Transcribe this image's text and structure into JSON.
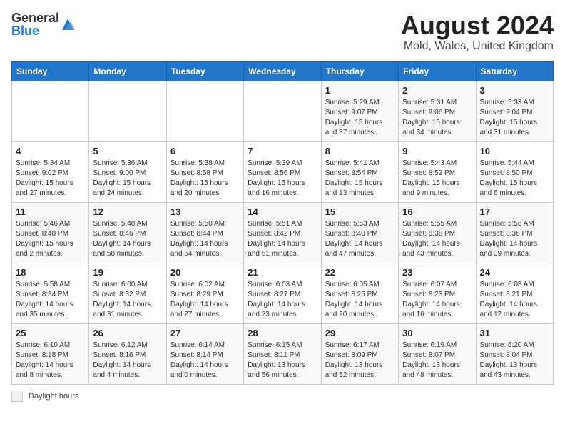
{
  "logo": {
    "text_general": "General",
    "text_blue": "Blue"
  },
  "header": {
    "title": "August 2024",
    "subtitle": "Mold, Wales, United Kingdom"
  },
  "days_of_week": [
    "Sunday",
    "Monday",
    "Tuesday",
    "Wednesday",
    "Thursday",
    "Friday",
    "Saturday"
  ],
  "weeks": [
    [
      {
        "day": "",
        "info": ""
      },
      {
        "day": "",
        "info": ""
      },
      {
        "day": "",
        "info": ""
      },
      {
        "day": "",
        "info": ""
      },
      {
        "day": "1",
        "info": "Sunrise: 5:29 AM\nSunset: 9:07 PM\nDaylight: 15 hours\nand 37 minutes."
      },
      {
        "day": "2",
        "info": "Sunrise: 5:31 AM\nSunset: 9:06 PM\nDaylight: 15 hours\nand 34 minutes."
      },
      {
        "day": "3",
        "info": "Sunrise: 5:33 AM\nSunset: 9:04 PM\nDaylight: 15 hours\nand 31 minutes."
      }
    ],
    [
      {
        "day": "4",
        "info": "Sunrise: 5:34 AM\nSunset: 9:02 PM\nDaylight: 15 hours\nand 27 minutes."
      },
      {
        "day": "5",
        "info": "Sunrise: 5:36 AM\nSunset: 9:00 PM\nDaylight: 15 hours\nand 24 minutes."
      },
      {
        "day": "6",
        "info": "Sunrise: 5:38 AM\nSunset: 8:58 PM\nDaylight: 15 hours\nand 20 minutes."
      },
      {
        "day": "7",
        "info": "Sunrise: 5:39 AM\nSunset: 8:56 PM\nDaylight: 15 hours\nand 16 minutes."
      },
      {
        "day": "8",
        "info": "Sunrise: 5:41 AM\nSunset: 8:54 PM\nDaylight: 15 hours\nand 13 minutes."
      },
      {
        "day": "9",
        "info": "Sunrise: 5:43 AM\nSunset: 8:52 PM\nDaylight: 15 hours\nand 9 minutes."
      },
      {
        "day": "10",
        "info": "Sunrise: 5:44 AM\nSunset: 8:50 PM\nDaylight: 15 hours\nand 6 minutes."
      }
    ],
    [
      {
        "day": "11",
        "info": "Sunrise: 5:46 AM\nSunset: 8:48 PM\nDaylight: 15 hours\nand 2 minutes."
      },
      {
        "day": "12",
        "info": "Sunrise: 5:48 AM\nSunset: 8:46 PM\nDaylight: 14 hours\nand 58 minutes."
      },
      {
        "day": "13",
        "info": "Sunrise: 5:50 AM\nSunset: 8:44 PM\nDaylight: 14 hours\nand 54 minutes."
      },
      {
        "day": "14",
        "info": "Sunrise: 5:51 AM\nSunset: 8:42 PM\nDaylight: 14 hours\nand 51 minutes."
      },
      {
        "day": "15",
        "info": "Sunrise: 5:53 AM\nSunset: 8:40 PM\nDaylight: 14 hours\nand 47 minutes."
      },
      {
        "day": "16",
        "info": "Sunrise: 5:55 AM\nSunset: 8:38 PM\nDaylight: 14 hours\nand 43 minutes."
      },
      {
        "day": "17",
        "info": "Sunrise: 5:56 AM\nSunset: 8:36 PM\nDaylight: 14 hours\nand 39 minutes."
      }
    ],
    [
      {
        "day": "18",
        "info": "Sunrise: 5:58 AM\nSunset: 8:34 PM\nDaylight: 14 hours\nand 35 minutes."
      },
      {
        "day": "19",
        "info": "Sunrise: 6:00 AM\nSunset: 8:32 PM\nDaylight: 14 hours\nand 31 minutes."
      },
      {
        "day": "20",
        "info": "Sunrise: 6:02 AM\nSunset: 8:29 PM\nDaylight: 14 hours\nand 27 minutes."
      },
      {
        "day": "21",
        "info": "Sunrise: 6:03 AM\nSunset: 8:27 PM\nDaylight: 14 hours\nand 23 minutes."
      },
      {
        "day": "22",
        "info": "Sunrise: 6:05 AM\nSunset: 8:25 PM\nDaylight: 14 hours\nand 20 minutes."
      },
      {
        "day": "23",
        "info": "Sunrise: 6:07 AM\nSunset: 8:23 PM\nDaylight: 14 hours\nand 16 minutes."
      },
      {
        "day": "24",
        "info": "Sunrise: 6:08 AM\nSunset: 8:21 PM\nDaylight: 14 hours\nand 12 minutes."
      }
    ],
    [
      {
        "day": "25",
        "info": "Sunrise: 6:10 AM\nSunset: 8:18 PM\nDaylight: 14 hours\nand 8 minutes."
      },
      {
        "day": "26",
        "info": "Sunrise: 6:12 AM\nSunset: 8:16 PM\nDaylight: 14 hours\nand 4 minutes."
      },
      {
        "day": "27",
        "info": "Sunrise: 6:14 AM\nSunset: 8:14 PM\nDaylight: 14 hours\nand 0 minutes."
      },
      {
        "day": "28",
        "info": "Sunrise: 6:15 AM\nSunset: 8:11 PM\nDaylight: 13 hours\nand 56 minutes."
      },
      {
        "day": "29",
        "info": "Sunrise: 6:17 AM\nSunset: 8:09 PM\nDaylight: 13 hours\nand 52 minutes."
      },
      {
        "day": "30",
        "info": "Sunrise: 6:19 AM\nSunset: 8:07 PM\nDaylight: 13 hours\nand 48 minutes."
      },
      {
        "day": "31",
        "info": "Sunrise: 6:20 AM\nSunset: 8:04 PM\nDaylight: 13 hours\nand 43 minutes."
      }
    ]
  ],
  "legend": {
    "label": "Daylight hours"
  }
}
